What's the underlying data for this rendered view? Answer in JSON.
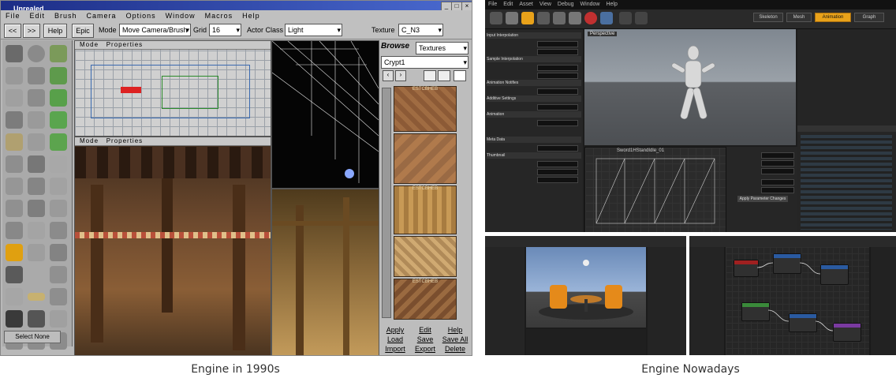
{
  "captions": {
    "left": "Engine in 1990s",
    "right": "Engine Nowadays"
  },
  "old_editor": {
    "title": "Unrealed",
    "menu": [
      "File",
      "Edit",
      "Brush",
      "Camera",
      "Options",
      "Window",
      "Macros",
      "Help"
    ],
    "toolbar": {
      "prev_label": "<<",
      "next_label": ">>",
      "help_label": "Help",
      "epic_label": "Epic",
      "mode_label": "Mode",
      "mode_value": "Move Camera/Brush",
      "grid_label": "Grid",
      "grid_value": "16",
      "actor_class_label": "Actor Class",
      "actor_class_value": "Light",
      "texture_label": "Texture",
      "texture_value": "C_N3"
    },
    "viewport_headers": {
      "mode": "Mode",
      "properties": "Properties"
    },
    "select_none_label": "Select None",
    "browser": {
      "browse_label": "Browse",
      "browse_value": "Textures",
      "package_value": "Crypt1",
      "texture_tag": "ESTCBHEB",
      "buttons": [
        [
          "Apply",
          "Edit",
          "Help"
        ],
        [
          "Load",
          "Save",
          "Save All"
        ],
        [
          "Import",
          "Export",
          "Delete"
        ]
      ]
    }
  },
  "new_editor": {
    "menu": [
      "File",
      "Edit",
      "Asset",
      "View",
      "Debug",
      "Window",
      "Help"
    ],
    "viewport_tag": "Perspective",
    "graph_title": "Sword1HStandIdle_01",
    "right_tabs": [
      "Skeleton",
      "Mesh",
      "Animation",
      "Graph"
    ],
    "panel_sections": [
      "Input Interpolation",
      "Sample Interpolation",
      "Animation Notifies",
      "Additive Settings",
      "Animation",
      "Meta Data",
      "Thumbnail"
    ],
    "apply_label": "Apply Parameter Changes"
  },
  "colors": {
    "old_bg": "#b9b9b9",
    "old_titlebar": "#1c2d86",
    "new_bg": "#1d1d1d",
    "new_accent": "#e9a21a"
  }
}
